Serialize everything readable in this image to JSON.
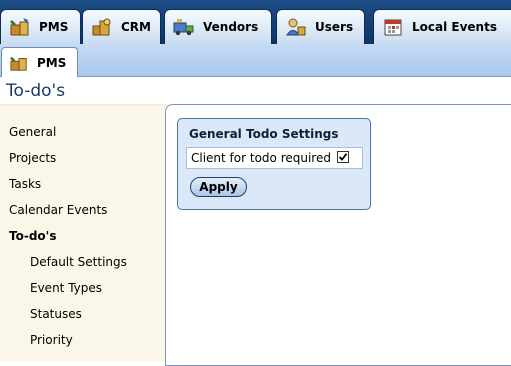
{
  "top_tabs": [
    {
      "label": "PMS",
      "icon": "pms-icon"
    },
    {
      "label": "CRM",
      "icon": "crm-icon"
    },
    {
      "label": "Vendors",
      "icon": "vendors-icon"
    },
    {
      "label": "Users",
      "icon": "users-icon"
    },
    {
      "label": "Local Events",
      "icon": "local-events-icon"
    }
  ],
  "sub_tab": {
    "label": "PMS",
    "icon": "pms-icon"
  },
  "page_title": "To-do's",
  "sidebar": {
    "items": [
      {
        "label": "General"
      },
      {
        "label": "Projects"
      },
      {
        "label": "Tasks"
      },
      {
        "label": "Calendar Events"
      },
      {
        "label": "To-do's"
      },
      {
        "label": "Default Settings"
      },
      {
        "label": "Event Types"
      },
      {
        "label": "Statuses"
      },
      {
        "label": "Priority"
      }
    ],
    "active_index": 4
  },
  "settings": {
    "title": "General Todo Settings",
    "row_label": "Client for todo required",
    "checked": true,
    "apply_label": "Apply"
  },
  "colors": {
    "topbar": "#1d4d86",
    "sidebar_bg": "#fbf7e8",
    "settings_bg": "#dbe8f7",
    "title_color": "#1a3c66"
  }
}
